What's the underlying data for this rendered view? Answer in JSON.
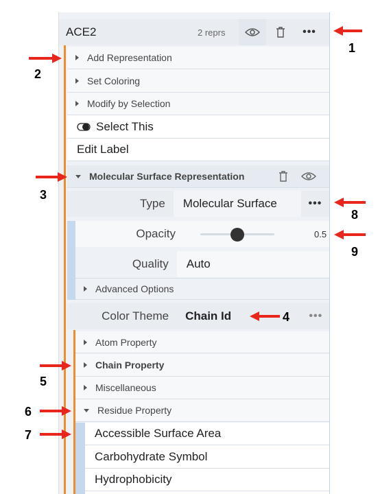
{
  "structure": {
    "title": "ACE2",
    "repr_count": "2 reprs",
    "actions": [
      "Add Representation",
      "Set Coloring",
      "Modify by Selection"
    ],
    "select_this": "Select This",
    "edit_label": "Edit Label"
  },
  "representation": {
    "title": "Molecular Surface Representation",
    "type_label": "Type",
    "type_value": "Molecular Surface",
    "opacity_label": "Opacity",
    "opacity_value": "0.5",
    "opacity_fraction": 0.5,
    "quality_label": "Quality",
    "quality_value": "Auto",
    "advanced_options": "Advanced Options",
    "color_theme_label": "Color Theme",
    "color_theme_value": "Chain Id"
  },
  "color_theme_groups": [
    {
      "label": "Atom Property",
      "bold": false,
      "expanded": false
    },
    {
      "label": "Chain Property",
      "bold": true,
      "expanded": false
    },
    {
      "label": "Miscellaneous",
      "bold": false,
      "expanded": false
    },
    {
      "label": "Residue Property",
      "bold": false,
      "expanded": true
    }
  ],
  "residue_options": [
    "Accessible Surface Area",
    "Carbohydrate Symbol",
    "Hydrophobicity"
  ],
  "annotations": [
    "1",
    "2",
    "3",
    "4",
    "5",
    "6",
    "7",
    "8",
    "9"
  ],
  "colors": {
    "accent_orange": "#f28c28",
    "arrow_red": "#e8261c",
    "panel_bg": "#eef1f5",
    "border_blue": "#c5d8ee"
  }
}
